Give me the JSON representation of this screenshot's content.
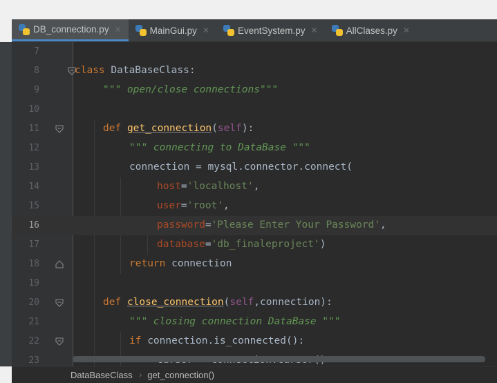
{
  "tabs": [
    {
      "label": "DB_connection.py",
      "active": true
    },
    {
      "label": "MainGui.py",
      "active": false
    },
    {
      "label": "EventSystem.py",
      "active": false
    },
    {
      "label": "AllClases.py",
      "active": false
    }
  ],
  "editor": {
    "current_line": 16,
    "lines": [
      {
        "num": "7"
      },
      {
        "num": "8"
      },
      {
        "num": "9"
      },
      {
        "num": "10"
      },
      {
        "num": "11"
      },
      {
        "num": "12"
      },
      {
        "num": "13"
      },
      {
        "num": "14"
      },
      {
        "num": "15"
      },
      {
        "num": "16"
      },
      {
        "num": "17"
      },
      {
        "num": "18"
      },
      {
        "num": "19"
      },
      {
        "num": "20"
      },
      {
        "num": "21"
      },
      {
        "num": "22"
      },
      {
        "num": "23"
      }
    ],
    "code": {
      "l8_kw": "class",
      "l8_name": " DataBaseClass:",
      "l9_doc": "\"\"\" open/close connections\"\"\"",
      "l11_kw": "def",
      "l11_fn": "get_connection",
      "l11_open": "(",
      "l11_self": "self",
      "l11_close": "):",
      "l12_doc": "\"\"\" connecting to DataBase \"\"\"",
      "l13_text": "connection = mysql.connector.connect(",
      "l14_param": "host",
      "l14_str": "'localhost'",
      "l15_param": "user",
      "l15_str": "'root'",
      "l16_param": "password",
      "l16_str": "'Please Enter Your Password'",
      "l17_param": "database",
      "l17_str": "'db_finaleproject'",
      "l17_close": ")",
      "l18_kw": "return",
      "l18_text": " connection",
      "l20_kw": "def",
      "l20_fn": "close_connection",
      "l20_open": "(",
      "l20_self": "self",
      "l20_rest": ",connection):",
      "l21_doc": "\"\"\" closing connection DataBase \"\"\"",
      "l22_kw": "if",
      "l22_text": " connection.is_connected():",
      "l23_text": "cursor = connection.cursor()",
      "eq": "=",
      "comma": ","
    }
  },
  "breadcrumb": {
    "items": [
      "DataBaseClass",
      "get_connection()"
    ],
    "separator": "›"
  },
  "colors": {
    "keyword": "#cc7832",
    "docstring": "#629755",
    "string": "#6a8759",
    "self": "#94558d",
    "function": "#ffc66d",
    "param": "#aa4926",
    "text": "#a9b7c6"
  }
}
